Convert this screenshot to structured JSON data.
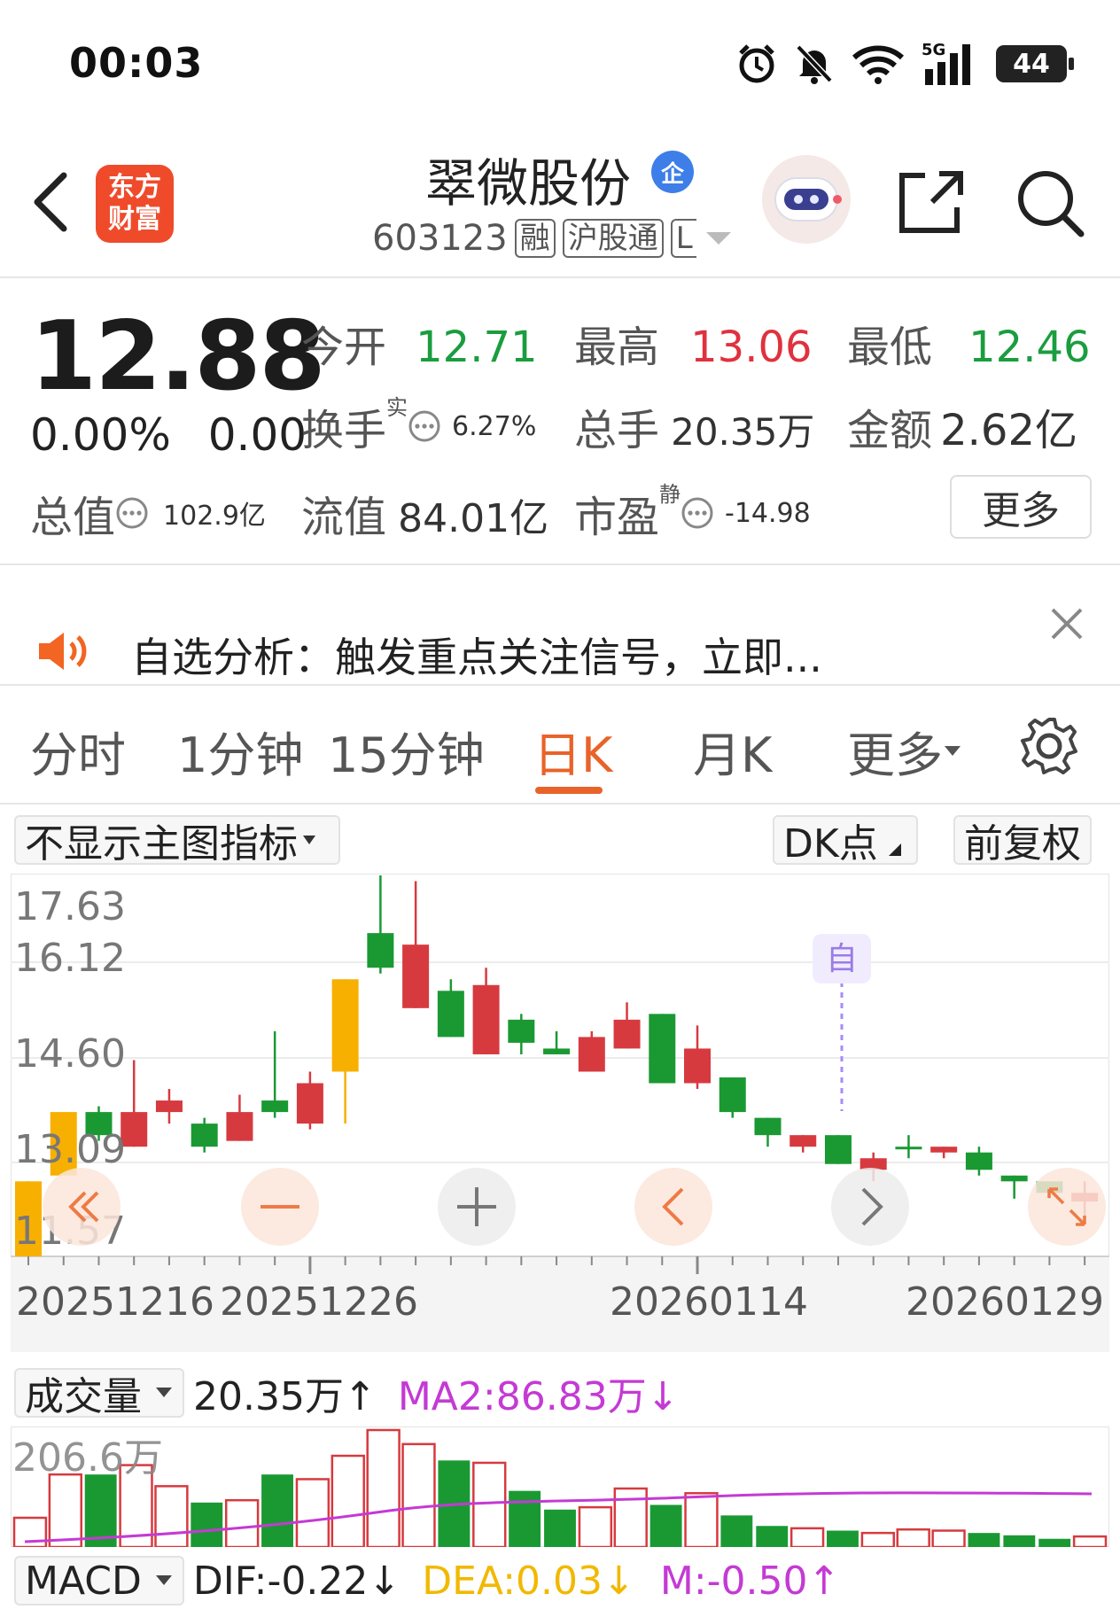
{
  "status": {
    "time": "00:03",
    "battery": "44",
    "network": "5G"
  },
  "header": {
    "logo_line1": "东方",
    "logo_line2": "财富",
    "stock_name": "翠微股份",
    "badge": "企",
    "code": "603123",
    "tags": [
      "融",
      "沪股通",
      "L"
    ]
  },
  "quote": {
    "price": "12.88",
    "change_pct": "0.00%",
    "change": "0.00",
    "open_label": "今开",
    "open": "12.71",
    "high_label": "最高",
    "high": "13.06",
    "low_label": "最低",
    "low": "12.46",
    "turnover_label": "换手",
    "turnover_sup": "实",
    "turnover": "6.27%",
    "volume_label": "总手",
    "volume": "20.35万",
    "amount_label": "金额",
    "amount": "2.62亿",
    "mktcap_label": "总值",
    "mktcap": "102.9亿",
    "float_label": "流值",
    "float": "84.01亿",
    "pe_label": "市盈",
    "pe_sup": "静",
    "pe": "-14.98",
    "more": "更多"
  },
  "notice": {
    "text": "自选分析：触发重点关注信号，立即..."
  },
  "tabs": [
    "分时",
    "1分钟",
    "15分钟",
    "日K",
    "月K",
    "更多"
  ],
  "active_tab": "日K",
  "chart_toolbar": {
    "indicator": "不显示主图指标",
    "dk": "DK点",
    "adjust": "前复权"
  },
  "chart_data": {
    "type": "candlestick",
    "y_ticks": [
      "17.63",
      "16.12",
      "14.60",
      "13.09",
      "11.57"
    ],
    "x_ticks": [
      "20251216",
      "20251226",
      "20260114",
      "20260129"
    ],
    "marker": "自",
    "candles": [
      {
        "o": 11.0,
        "c": 12.3,
        "h": 12.3,
        "l": 11.0,
        "color": "yellow"
      },
      {
        "o": 12.4,
        "c": 13.5,
        "h": 13.5,
        "l": 12.4,
        "color": "yellow"
      },
      {
        "o": 13.5,
        "c": 13.1,
        "h": 13.6,
        "l": 13.0,
        "color": "green"
      },
      {
        "o": 12.9,
        "c": 13.5,
        "h": 14.4,
        "l": 12.9,
        "color": "red"
      },
      {
        "o": 13.5,
        "c": 13.7,
        "h": 13.9,
        "l": 13.3,
        "color": "red"
      },
      {
        "o": 13.3,
        "c": 12.9,
        "h": 13.4,
        "l": 12.8,
        "color": "green"
      },
      {
        "o": 13.0,
        "c": 13.5,
        "h": 13.8,
        "l": 13.0,
        "color": "red"
      },
      {
        "o": 13.7,
        "c": 13.5,
        "h": 14.9,
        "l": 13.4,
        "color": "green"
      },
      {
        "o": 13.3,
        "c": 14.0,
        "h": 14.2,
        "l": 13.2,
        "color": "red"
      },
      {
        "o": 14.2,
        "c": 15.8,
        "h": 15.8,
        "l": 13.3,
        "color": "yellow"
      },
      {
        "o": 16.6,
        "c": 16.0,
        "h": 17.6,
        "l": 15.9,
        "color": "green"
      },
      {
        "o": 16.4,
        "c": 15.3,
        "h": 17.5,
        "l": 15.3,
        "color": "red"
      },
      {
        "o": 15.6,
        "c": 14.8,
        "h": 15.8,
        "l": 14.8,
        "color": "green"
      },
      {
        "o": 15.7,
        "c": 14.5,
        "h": 16.0,
        "l": 14.5,
        "color": "red"
      },
      {
        "o": 15.1,
        "c": 14.7,
        "h": 15.2,
        "l": 14.5,
        "color": "green"
      },
      {
        "o": 14.6,
        "c": 14.5,
        "h": 14.9,
        "l": 14.5,
        "color": "green"
      },
      {
        "o": 14.8,
        "c": 14.2,
        "h": 14.9,
        "l": 14.2,
        "color": "red"
      },
      {
        "o": 15.1,
        "c": 14.6,
        "h": 15.4,
        "l": 14.6,
        "color": "red"
      },
      {
        "o": 15.2,
        "c": 14.0,
        "h": 15.2,
        "l": 14.0,
        "color": "green"
      },
      {
        "o": 14.6,
        "c": 14.0,
        "h": 15.0,
        "l": 13.9,
        "color": "red"
      },
      {
        "o": 14.1,
        "c": 13.5,
        "h": 14.1,
        "l": 13.4,
        "color": "green"
      },
      {
        "o": 13.4,
        "c": 13.1,
        "h": 13.4,
        "l": 12.9,
        "color": "green"
      },
      {
        "o": 13.1,
        "c": 12.9,
        "h": 13.1,
        "l": 12.8,
        "color": "red"
      },
      {
        "o": 13.1,
        "c": 12.6,
        "h": 13.1,
        "l": 12.6,
        "color": "green"
      },
      {
        "o": 12.7,
        "c": 12.5,
        "h": 12.8,
        "l": 12.3,
        "color": "red"
      },
      {
        "o": 12.9,
        "c": 12.9,
        "h": 13.1,
        "l": 12.7,
        "color": "green"
      },
      {
        "o": 12.9,
        "c": 12.8,
        "h": 12.9,
        "l": 12.7,
        "color": "red"
      },
      {
        "o": 12.8,
        "c": 12.5,
        "h": 12.9,
        "l": 12.4,
        "color": "green"
      },
      {
        "o": 12.4,
        "c": 12.3,
        "h": 12.4,
        "l": 12.0,
        "color": "green"
      },
      {
        "o": 12.3,
        "c": 12.1,
        "h": 12.3,
        "l": 12.0,
        "color": "green"
      },
      {
        "o": 12.1,
        "c": 11.95,
        "h": 12.3,
        "l": 11.7,
        "color": "red"
      }
    ]
  },
  "volume_panel": {
    "label": "成交量",
    "value": "20.35万↑",
    "ma2": "MA2:86.83万↓",
    "y_label": "206.6万",
    "bars": [
      {
        "v": 0.25,
        "color": "red"
      },
      {
        "v": 0.62,
        "color": "red"
      },
      {
        "v": 0.62,
        "color": "green"
      },
      {
        "v": 0.7,
        "color": "red"
      },
      {
        "v": 0.52,
        "color": "red"
      },
      {
        "v": 0.38,
        "color": "green"
      },
      {
        "v": 0.4,
        "color": "red"
      },
      {
        "v": 0.62,
        "color": "green"
      },
      {
        "v": 0.58,
        "color": "red"
      },
      {
        "v": 0.78,
        "color": "red"
      },
      {
        "v": 1.0,
        "color": "red"
      },
      {
        "v": 0.88,
        "color": "red"
      },
      {
        "v": 0.74,
        "color": "green"
      },
      {
        "v": 0.72,
        "color": "red"
      },
      {
        "v": 0.48,
        "color": "green"
      },
      {
        "v": 0.32,
        "color": "green"
      },
      {
        "v": 0.34,
        "color": "red"
      },
      {
        "v": 0.5,
        "color": "red"
      },
      {
        "v": 0.36,
        "color": "green"
      },
      {
        "v": 0.46,
        "color": "red"
      },
      {
        "v": 0.27,
        "color": "green"
      },
      {
        "v": 0.18,
        "color": "green"
      },
      {
        "v": 0.16,
        "color": "red"
      },
      {
        "v": 0.14,
        "color": "green"
      },
      {
        "v": 0.12,
        "color": "red"
      },
      {
        "v": 0.15,
        "color": "red"
      },
      {
        "v": 0.14,
        "color": "red"
      },
      {
        "v": 0.12,
        "color": "green"
      },
      {
        "v": 0.1,
        "color": "green"
      },
      {
        "v": 0.07,
        "color": "green"
      },
      {
        "v": 0.09,
        "color": "red"
      }
    ]
  },
  "macd_panel": {
    "label": "MACD",
    "dif": "DIF:-0.22↓",
    "dea": "DEA:0.03↓",
    "m": "M:-0.50↑"
  }
}
